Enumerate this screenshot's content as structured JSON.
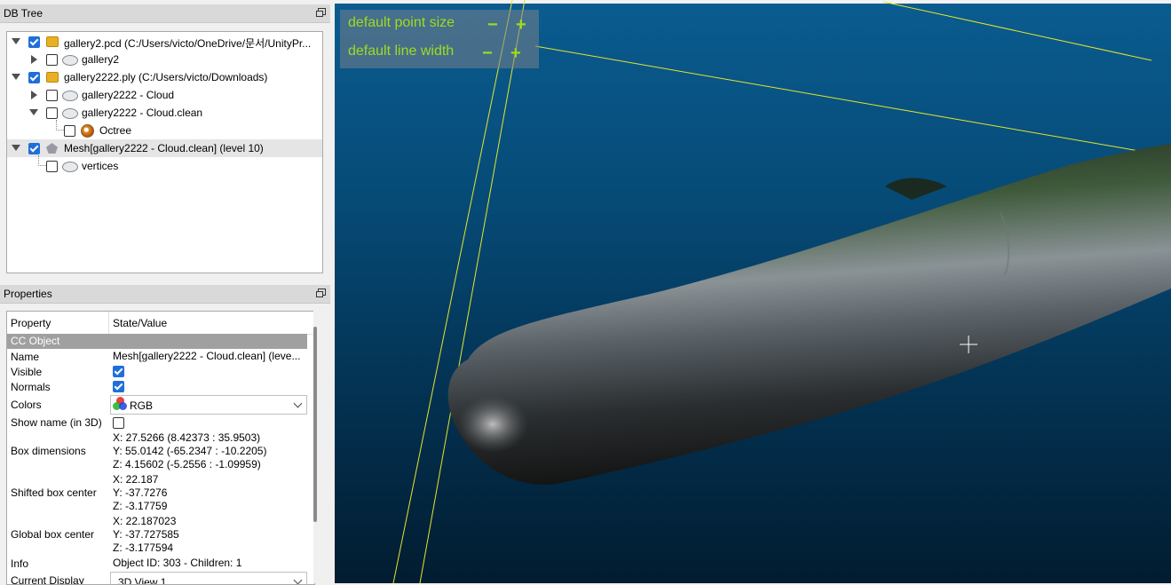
{
  "db_tree": {
    "title": "DB Tree",
    "nodes": [
      {
        "label": "gallery2.pcd (C:/Users/victo/OneDrive/문서/UnityPr..."
      },
      {
        "label": "gallery2"
      },
      {
        "label": "gallery2222.ply (C:/Users/victo/Downloads)"
      },
      {
        "label": "gallery2222 - Cloud"
      },
      {
        "label": "gallery2222 - Cloud.clean"
      },
      {
        "label": "Octree"
      },
      {
        "label": "Mesh[gallery2222 - Cloud.clean] (level 10)"
      },
      {
        "label": "vertices"
      }
    ]
  },
  "properties": {
    "title": "Properties",
    "col_property": "Property",
    "col_value": "State/Value",
    "section": "CC Object",
    "rows": {
      "name_k": "Name",
      "name_v": "Mesh[gallery2222 - Cloud.clean] (leve...",
      "visible_k": "Visible",
      "normals_k": "Normals",
      "colors_k": "Colors",
      "colors_v": "RGB",
      "showname_k": "Show name (in 3D)",
      "boxdim_k": "Box dimensions",
      "boxdim_x": "X: 27.5266 (8.42373 : 35.9503)",
      "boxdim_y": "Y: 55.0142 (-65.2347 : -10.2205)",
      "boxdim_z": "Z: 4.15602 (-5.2556 : -1.09959)",
      "shifted_k": "Shifted box center",
      "shifted_x": "X: 22.187",
      "shifted_y": "Y: -37.7276",
      "shifted_z": "Z: -3.17759",
      "global_k": "Global box center",
      "global_x": "X: 22.187023",
      "global_y": "Y: -37.727585",
      "global_z": "Z: -3.177594",
      "info_k": "Info",
      "info_v": "Object ID: 303 - Children: 1",
      "display_k": "Current Display",
      "display_v": "3D View 1"
    }
  },
  "view": {
    "point_size_label": "default point size",
    "line_width_label": "default line width",
    "minus": "−",
    "plus": "+"
  }
}
